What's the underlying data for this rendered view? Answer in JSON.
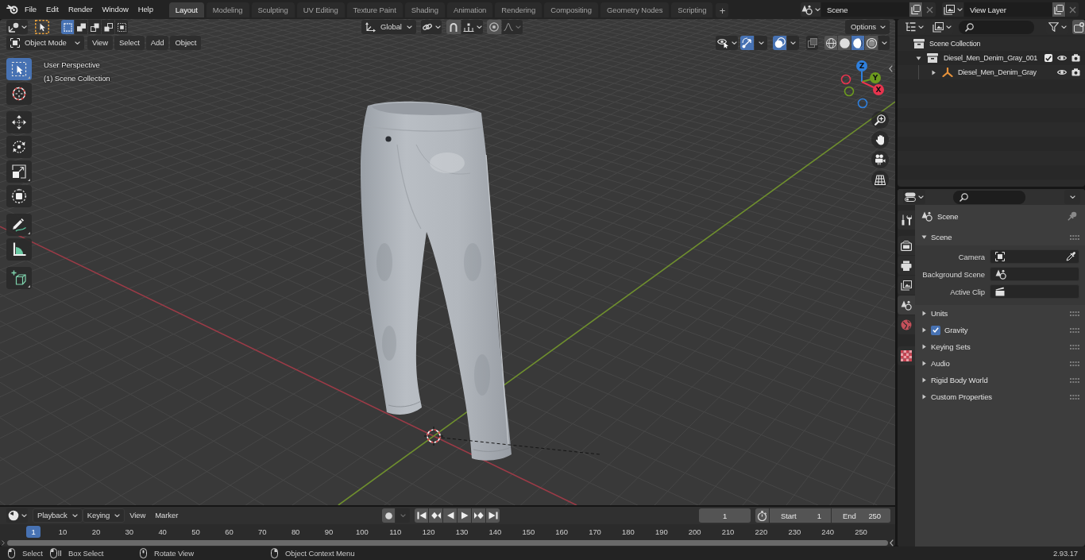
{
  "topbar": {
    "menus": [
      "File",
      "Edit",
      "Render",
      "Window",
      "Help"
    ],
    "workspaces": [
      {
        "label": "Layout",
        "selected": true
      },
      {
        "label": "Modeling",
        "selected": false
      },
      {
        "label": "Sculpting",
        "selected": false
      },
      {
        "label": "UV Editing",
        "selected": false
      },
      {
        "label": "Texture Paint",
        "selected": false
      },
      {
        "label": "Shading",
        "selected": false
      },
      {
        "label": "Animation",
        "selected": false
      },
      {
        "label": "Rendering",
        "selected": false
      },
      {
        "label": "Compositing",
        "selected": false
      },
      {
        "label": "Geometry Nodes",
        "selected": false
      },
      {
        "label": "Scripting",
        "selected": false
      }
    ],
    "add_workspace": "+",
    "scene": "Scene",
    "view_layer": "View Layer"
  },
  "viewport": {
    "tool_header": {
      "select_modes": [
        {
          "selected": true
        },
        {
          "selected": false
        },
        {
          "selected": false
        },
        {
          "selected": false
        },
        {
          "selected": false
        }
      ],
      "orientation": "Global",
      "snap": false,
      "proportional_editing": false,
      "options": "Options"
    },
    "header": {
      "mode": "Object Mode",
      "menus": [
        "View",
        "Select",
        "Add",
        "Object"
      ],
      "gizmos": true,
      "overlays": true,
      "xray": false,
      "shading_modes": [
        {
          "selected": false
        },
        {
          "selected": false
        },
        {
          "selected": true
        },
        {
          "selected": false
        }
      ]
    },
    "tool_groups": [
      [
        {
          "kind": "select_box",
          "selected": true
        },
        {
          "kind": "cursor",
          "selected": false
        }
      ],
      [
        {
          "kind": "move",
          "selected": false
        },
        {
          "kind": "rotate",
          "selected": false
        },
        {
          "kind": "scale",
          "selected": false
        },
        {
          "kind": "transform",
          "selected": false
        }
      ],
      [
        {
          "kind": "annotate",
          "selected": false
        },
        {
          "kind": "measure",
          "selected": false
        }
      ],
      [
        {
          "kind": "add_cube",
          "selected": false
        }
      ]
    ],
    "view_name": "User Perspective",
    "collection": "(1) Scene Collection",
    "axes": [
      {
        "label": "Z",
        "color": "#2f7fdc"
      },
      {
        "label": "Y",
        "color": "#6c9a1e"
      },
      {
        "label": "X",
        "color": "#e8344e"
      }
    ]
  },
  "outliner": {
    "root": "Scene Collection",
    "items": [
      {
        "name": "Diesel_Men_Denim_Gray_001",
        "kind": "collection",
        "expanded": true,
        "checked": true,
        "visible": true,
        "renderable": true,
        "children": [
          {
            "name": "Diesel_Men_Denim_Gray",
            "kind": "armature",
            "expanded": false,
            "visible": true,
            "renderable": true
          }
        ]
      }
    ]
  },
  "properties": {
    "tab_groups": [
      [
        {
          "kind": "tool",
          "selected": false
        }
      ],
      [
        {
          "kind": "render",
          "selected": false
        },
        {
          "kind": "output",
          "selected": false
        },
        {
          "kind": "view_layer",
          "selected": false
        },
        {
          "kind": "scene",
          "selected": true
        },
        {
          "kind": "world",
          "selected": false
        }
      ],
      [
        {
          "kind": "texture",
          "selected": false
        }
      ]
    ],
    "context": "Scene",
    "panels": [
      {
        "title": "Scene",
        "kind": "plain",
        "expanded": true,
        "fields": [
          {
            "label": "Camera",
            "kind": "object"
          },
          {
            "label": "Background Scene",
            "kind": "scene"
          },
          {
            "label": "Active Clip",
            "kind": "clip"
          }
        ]
      },
      {
        "title": "Units",
        "kind": "plain",
        "expanded": false
      },
      {
        "title": "Gravity",
        "kind": "toggle",
        "checked": true,
        "expanded": false
      },
      {
        "title": "Keying Sets",
        "kind": "plain",
        "expanded": false
      },
      {
        "title": "Audio",
        "kind": "plain",
        "expanded": false
      },
      {
        "title": "Rigid Body World",
        "kind": "plain",
        "expanded": false
      },
      {
        "title": "Custom Properties",
        "kind": "plain",
        "expanded": false
      }
    ]
  },
  "timeline": {
    "menus": [
      {
        "label": "Playback",
        "kind": "dropdown"
      },
      {
        "label": "Keying",
        "kind": "dropdown"
      },
      {
        "label": "View",
        "kind": "plain"
      },
      {
        "label": "Marker",
        "kind": "plain"
      }
    ],
    "auto_keying": false,
    "current_frame": "1",
    "start_label": "Start",
    "start": "1",
    "end_label": "End",
    "end": "250",
    "playhead": "1",
    "ruler": [
      "10",
      "20",
      "30",
      "40",
      "50",
      "60",
      "70",
      "80",
      "90",
      "100",
      "110",
      "120",
      "130",
      "140",
      "150",
      "160",
      "170",
      "180",
      "190",
      "200",
      "210",
      "220",
      "230",
      "240",
      "250"
    ]
  },
  "status_bar": {
    "hints": [
      {
        "label": "Select",
        "kind": "left_click"
      },
      {
        "label": "Box Select",
        "kind": "left_drag"
      },
      {
        "label": "Rotate View",
        "kind": "middle_click"
      },
      {
        "label": "Object Context Menu",
        "kind": "right_click"
      }
    ],
    "version": "2.93.17"
  }
}
